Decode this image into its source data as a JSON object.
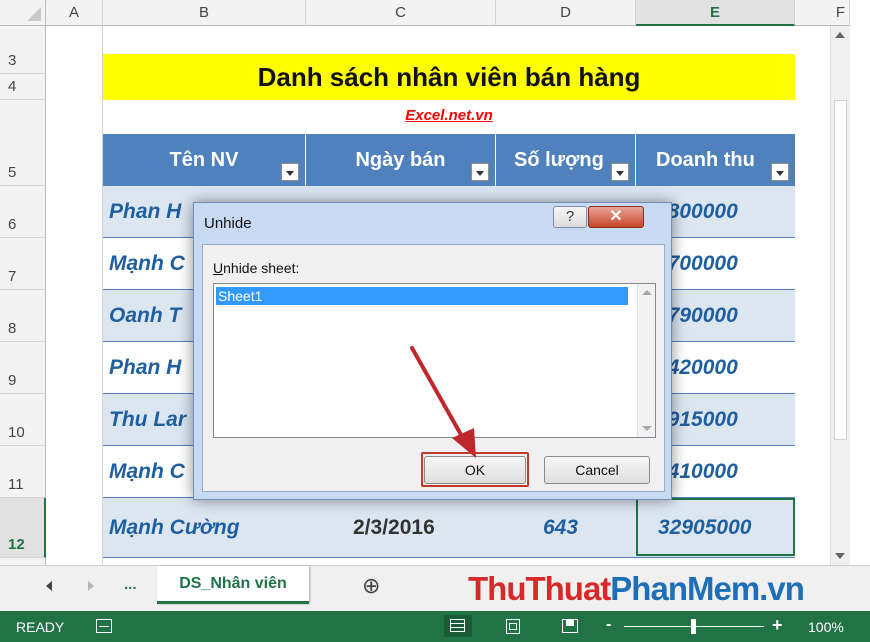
{
  "columns": [
    "A",
    "B",
    "C",
    "D",
    "E",
    "F"
  ],
  "rows": [
    "3",
    "4",
    "5",
    "6",
    "7",
    "8",
    "9",
    "10",
    "11",
    "12"
  ],
  "sheet": {
    "title": "Danh sách nhân viên bán hàng",
    "subtitle": "Excel.net.vn",
    "headers": [
      "Tên NV",
      "Ngày bán",
      "Số lượng",
      "Doanh thu"
    ],
    "data": [
      [
        "Phan H",
        "",
        "",
        "7800000"
      ],
      [
        "Mạnh C",
        "",
        "",
        "6700000"
      ],
      [
        "Oanh T",
        "",
        "",
        "6790000"
      ],
      [
        "Phan H",
        "",
        "",
        "9420000"
      ],
      [
        "Thu Lar",
        "",
        "",
        "3915000"
      ],
      [
        "Mạnh C",
        "",
        "",
        "8410000"
      ],
      [
        "Mạnh Cường",
        "2/3/2016",
        "643",
        "32905000"
      ]
    ]
  },
  "dialog": {
    "title": "Unhide",
    "help_glyph": "?",
    "close_glyph": "✕",
    "label_underline": "U",
    "label_rest": "nhide sheet:",
    "items": [
      "Sheet1"
    ],
    "ok": "OK",
    "cancel": "Cancel"
  },
  "tabs": {
    "ellipsis": "...",
    "active": "DS_Nhân viên",
    "add": "⊕"
  },
  "watermark": {
    "part1": "ThuThuat",
    "part2": "PhanMem",
    "part3": ".vn"
  },
  "status": {
    "ready": "READY",
    "zoom": "100%",
    "minus": "-",
    "plus": "+"
  },
  "colors": {
    "excel_green": "#217346",
    "header_blue": "#4f81bd",
    "title_yellow": "#ffff00"
  }
}
